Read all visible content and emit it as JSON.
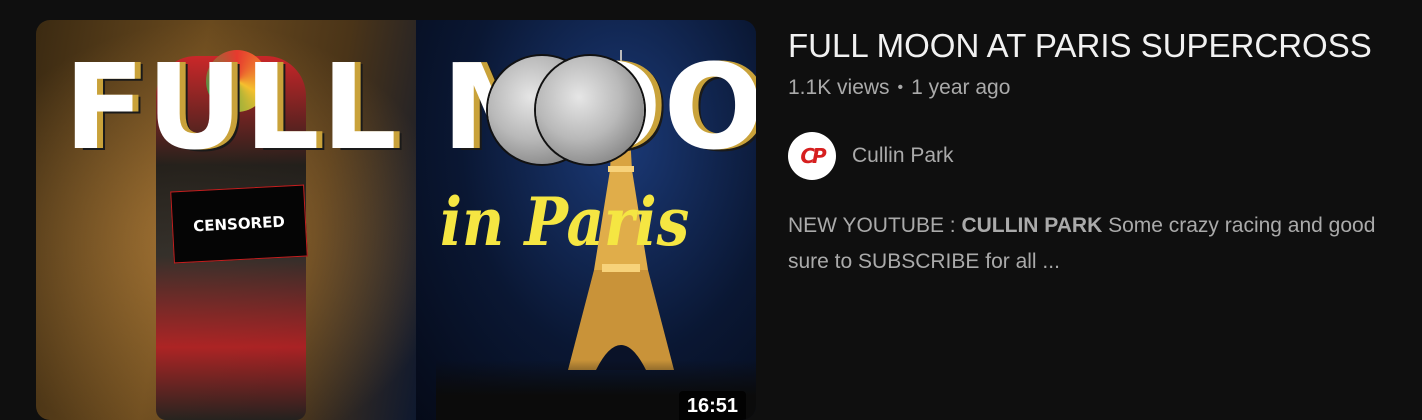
{
  "video": {
    "thumbnail": {
      "title_art": "FULL MOON",
      "subtitle_art": "in Paris",
      "censor_label": "CENSORED",
      "duration": "16:51"
    },
    "title": "FULL MOON AT PARIS SUPERCROSS",
    "views": "1.1K views",
    "separator": "•",
    "age": "1 year ago",
    "channel": {
      "avatar_text": "CP",
      "name": "Cullin Park"
    },
    "description": {
      "prefix": "NEW YOUTUBE : ",
      "bold": "CULLIN PARK",
      "line1_rest": " Some crazy racing and good",
      "line2": "sure to SUBSCRIBE for all ..."
    }
  },
  "colors": {
    "background": "#0f0f0f",
    "title_text": "#f1f1f1",
    "secondary_text": "#aaaaaa",
    "paris_text": "#f5e642",
    "avatar_accent": "#d61f1f"
  }
}
